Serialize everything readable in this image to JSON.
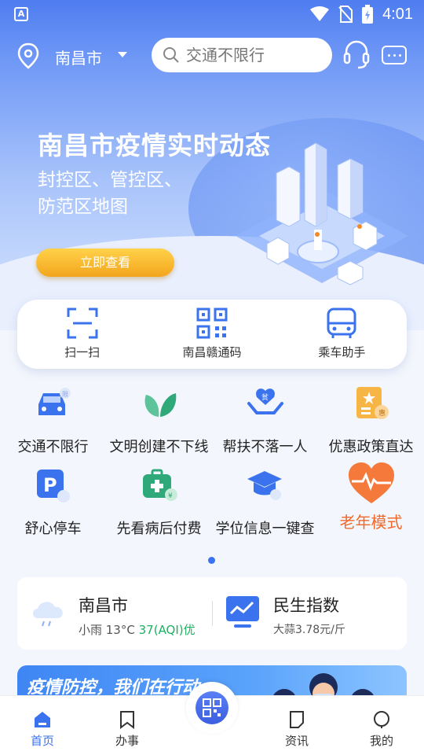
{
  "status": {
    "time": "4:01",
    "app_badge": "A"
  },
  "header": {
    "city": "南昌市",
    "search_placeholder": "交通不限行"
  },
  "banner": {
    "title": "南昌市疫情实时动态",
    "subtitle_line1": "封控区、管控区、",
    "subtitle_line2": "防范区地图",
    "button": "立即查看"
  },
  "quick": [
    {
      "label": "扫一扫",
      "icon": "scan-icon"
    },
    {
      "label": "南昌赣通码",
      "icon": "qr-code-icon"
    },
    {
      "label": "乘车助手",
      "icon": "bus-icon"
    }
  ],
  "grid": {
    "row1": [
      {
        "label": "交通不限行",
        "icon": "car-icon"
      },
      {
        "label": "文明创建不下线",
        "icon": "leaf-icon"
      },
      {
        "label": "帮扶不落一人",
        "icon": "helping-hands-icon"
      },
      {
        "label": "优惠政策直达",
        "icon": "policy-icon"
      }
    ],
    "row2": [
      {
        "label": "舒心停车",
        "icon": "parking-icon"
      },
      {
        "label": "先看病后付费",
        "icon": "medical-kit-icon"
      },
      {
        "label": "学位信息一键查",
        "icon": "graduation-cap-icon"
      },
      {
        "label": "老年模式",
        "icon": "heart-icon"
      }
    ]
  },
  "weather": {
    "city": "南昌市",
    "condition": "小雨 13°C",
    "aqi": "37(AQI)优"
  },
  "livelihood": {
    "title": "民生指数",
    "detail": "大蒜3.78元/斤"
  },
  "promo": {
    "text": "疫情防控，我们在行动"
  },
  "tabs": [
    {
      "label": "首页",
      "active": true
    },
    {
      "label": "办事"
    },
    {
      "label": ""
    },
    {
      "label": "资讯"
    },
    {
      "label": "我的"
    }
  ],
  "colors": {
    "accent": "#3b73ee",
    "elder": "#f06a2c",
    "aqi_good": "#18b35f"
  }
}
